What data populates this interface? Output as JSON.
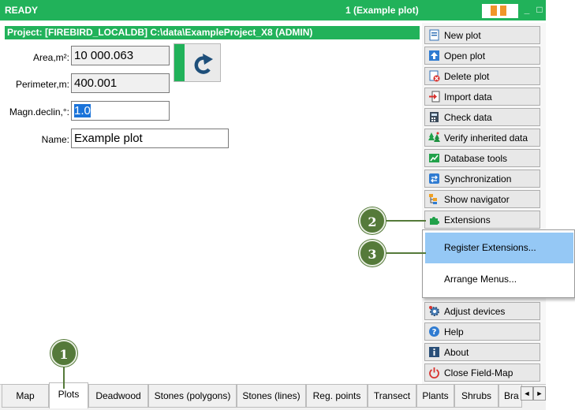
{
  "titlebar": {
    "status": "READY",
    "window_title": "1 (Example plot)",
    "minimize": "_",
    "maximize": "□"
  },
  "project_bar": {
    "text": "Project:  [FIREBIRD_LOCALDB] C:\\data\\ExampleProject_X8   (ADMIN)"
  },
  "form": {
    "area": {
      "label": "Area,m²:",
      "value": "10 000.063"
    },
    "perimeter": {
      "label": "Perimeter,m:",
      "value": "400.001"
    },
    "magn_declin": {
      "label": "Magn.declin,°:",
      "value": "1.0"
    },
    "name": {
      "label": "Name:",
      "value": "Example plot"
    }
  },
  "menu": {
    "new_plot": "New plot",
    "open_plot": "Open plot",
    "delete_plot": "Delete plot",
    "import_data": "Import data",
    "check_data": "Check data",
    "verify_inherited": "Verify inherited data",
    "database_tools": "Database tools",
    "synchronization": "Synchronization",
    "show_navigator": "Show navigator",
    "extensions": "Extensions",
    "adjust_devices": "Adjust devices",
    "help": "Help",
    "about": "About",
    "close": "Close Field-Map"
  },
  "popup": {
    "register": "Register Extensions...",
    "arrange": "Arrange Menus..."
  },
  "callouts": {
    "c1": "1",
    "c2": "2",
    "c3": "3"
  },
  "tabs": [
    "Map",
    "Plots",
    "Deadwood",
    "Stones (polygons)",
    "Stones (lines)",
    "Reg. points",
    "Transect",
    "Plants",
    "Shrubs",
    "Bra"
  ],
  "tab_arrows": {
    "left": "◄",
    "right": "►"
  },
  "colors": {
    "accent_green": "#21b25a",
    "callout_green": "#557a3a",
    "highlight": "#95c8f5",
    "selection": "#1a73d9"
  }
}
